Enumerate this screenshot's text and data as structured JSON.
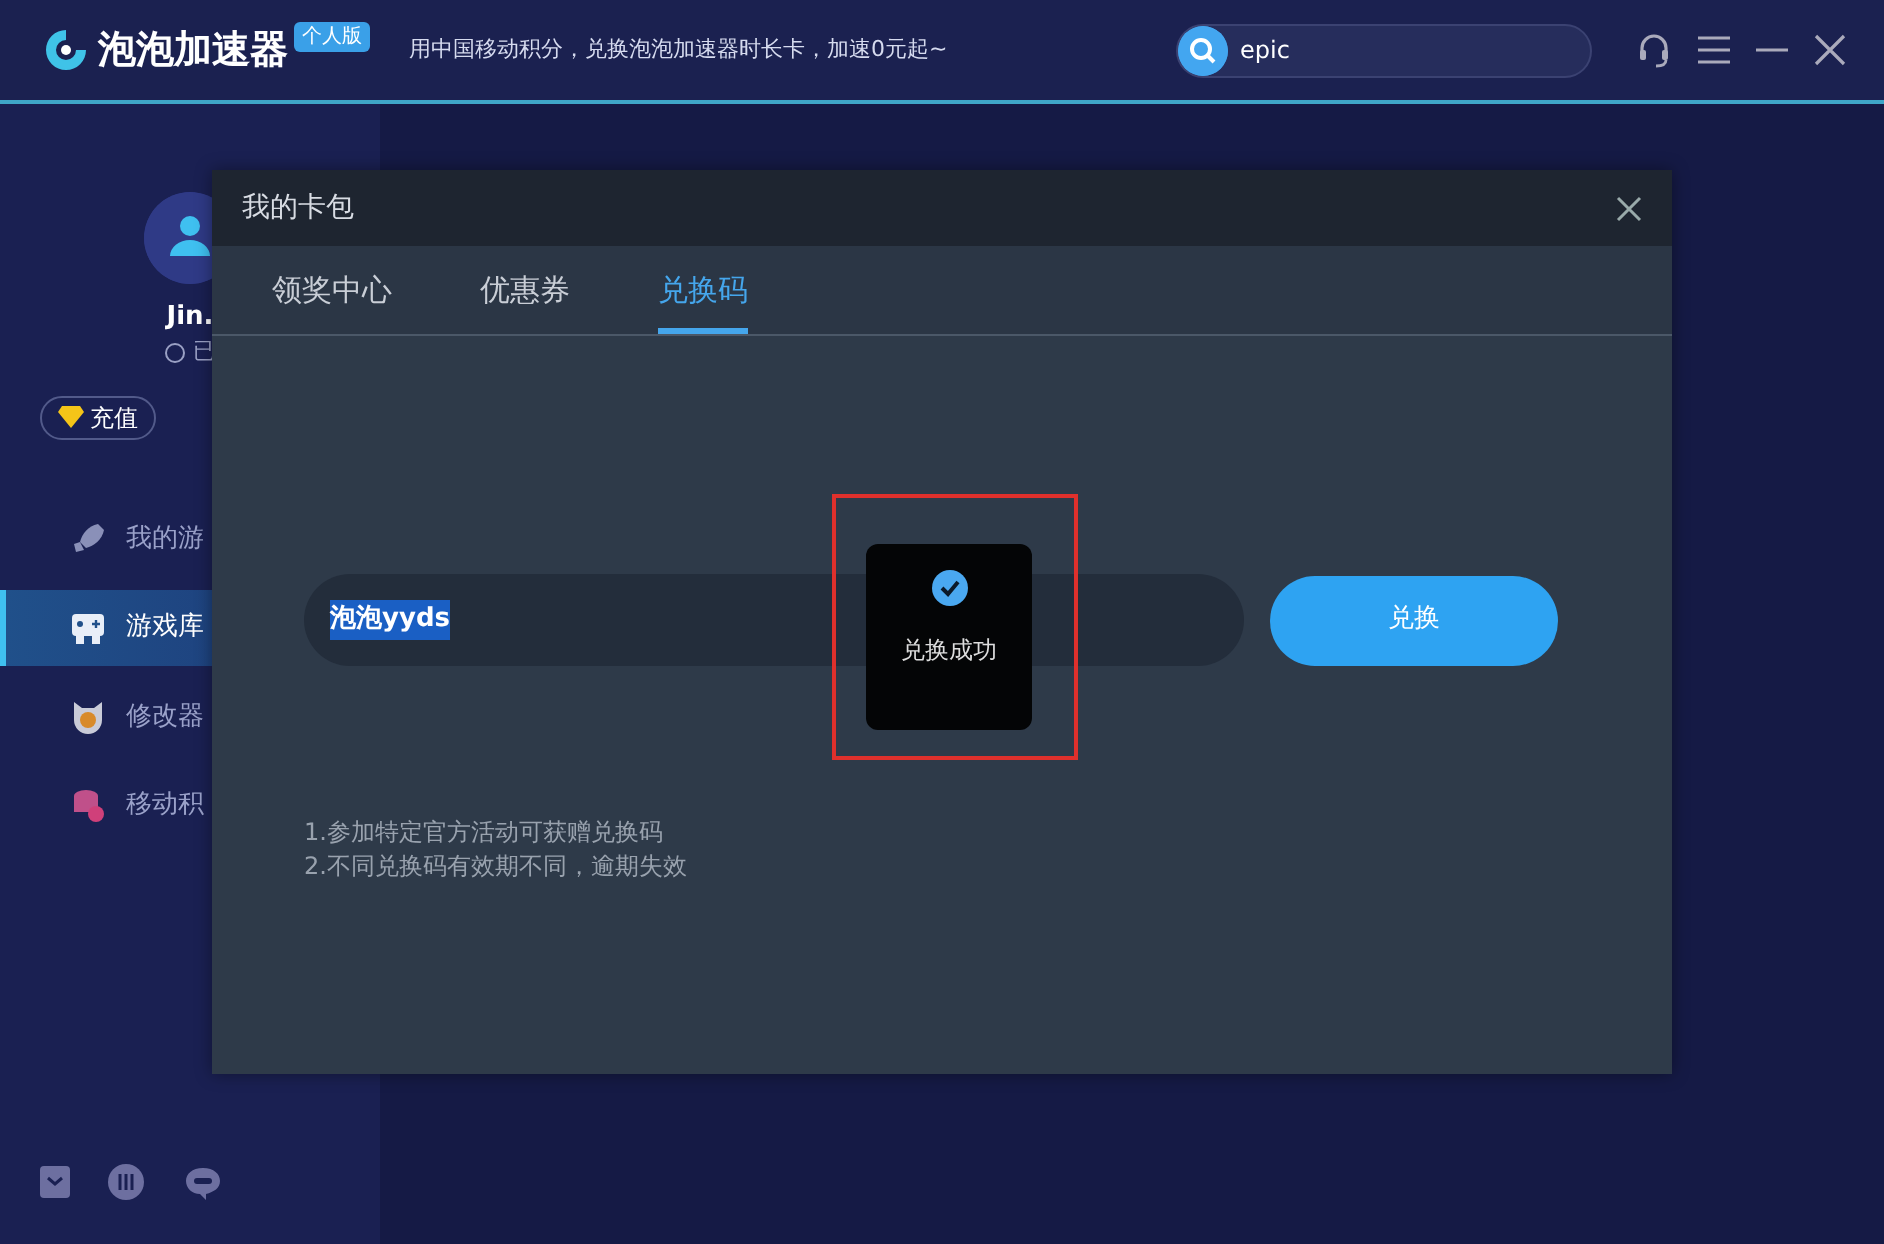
{
  "app": {
    "brand": "泡泡加速器",
    "edition": "个人版",
    "slogan": "用中国移动积分，兑换泡泡加速器时长卡，加速0元起~",
    "search": {
      "value": "epic"
    }
  },
  "user": {
    "name": "Jin.",
    "status": "已",
    "recharge": "充值"
  },
  "sidebar": {
    "items": [
      {
        "label": "我的游",
        "selected": false
      },
      {
        "label": "游戏库",
        "selected": true
      },
      {
        "label": "修改器",
        "selected": false
      },
      {
        "label": "移动积",
        "selected": false
      }
    ]
  },
  "dialog": {
    "title": "我的卡包",
    "tabs": [
      {
        "label": "领奖中心",
        "selected": false
      },
      {
        "label": "优惠券",
        "selected": false
      },
      {
        "label": "兑换码",
        "selected": true
      }
    ],
    "code": {
      "value": "泡泡yyds"
    },
    "button": "兑换",
    "toast": "兑换成功",
    "notes": [
      "1.参加特定官方活动可获赠兑换码",
      "2.不同兑换码有效期不同，逾期失效"
    ]
  }
}
